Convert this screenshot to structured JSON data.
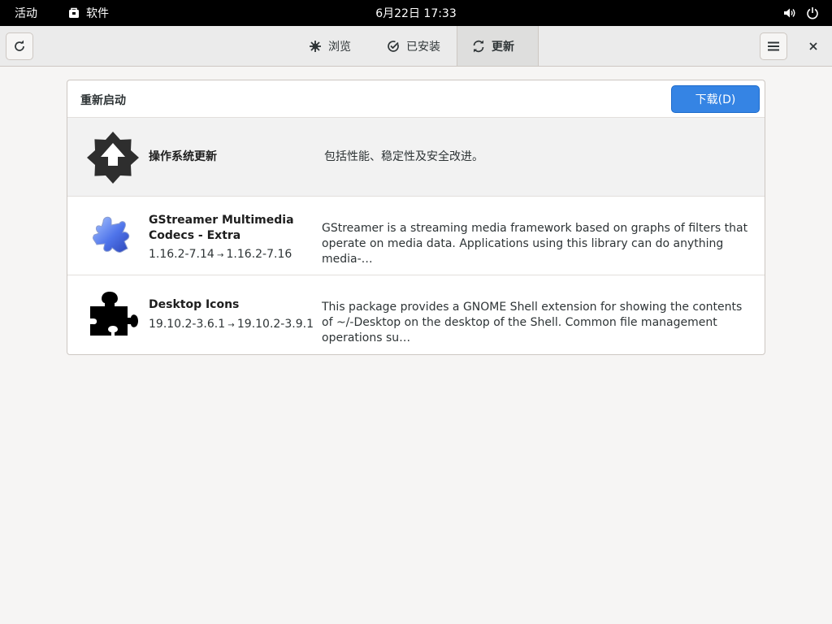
{
  "topbar": {
    "activities": "活动",
    "app_name": "软件",
    "clock": "6月22日  17:33"
  },
  "tabs": [
    {
      "label": "浏览",
      "icon": "explore-icon",
      "active": false
    },
    {
      "label": "已安装",
      "icon": "check-icon",
      "active": false
    },
    {
      "label": "更新",
      "icon": "refresh-icon",
      "active": true
    }
  ],
  "card": {
    "title": "重新启动",
    "download_label": "下载(D)"
  },
  "updates": [
    {
      "name": "操作系统更新",
      "version_from": "",
      "version_to": "",
      "description": "包括性能、稳定性及安全改进。",
      "icon": "os-update-icon"
    },
    {
      "name": "GStreamer Multimedia Codecs - Extra",
      "version_from": "1.16.2-7.14",
      "version_to": "1.16.2-7.16",
      "description": "GStreamer is a streaming media framework based on graphs of filters that operate on media data. Applications using this library can do anything media-…",
      "icon": "puzzle-blue-icon"
    },
    {
      "name": "Desktop Icons",
      "version_from": "19.10.2-3.6.1",
      "version_to": "19.10.2-3.9.1",
      "description": "This package provides a GNOME Shell extension for showing the contents of ~/-Desktop on the desktop of the Shell. Common file management operations su…",
      "icon": "puzzle-black-icon"
    }
  ],
  "colors": {
    "accent": "#3584e4",
    "topbar": "#000000",
    "window_bg": "#f6f5f4"
  }
}
